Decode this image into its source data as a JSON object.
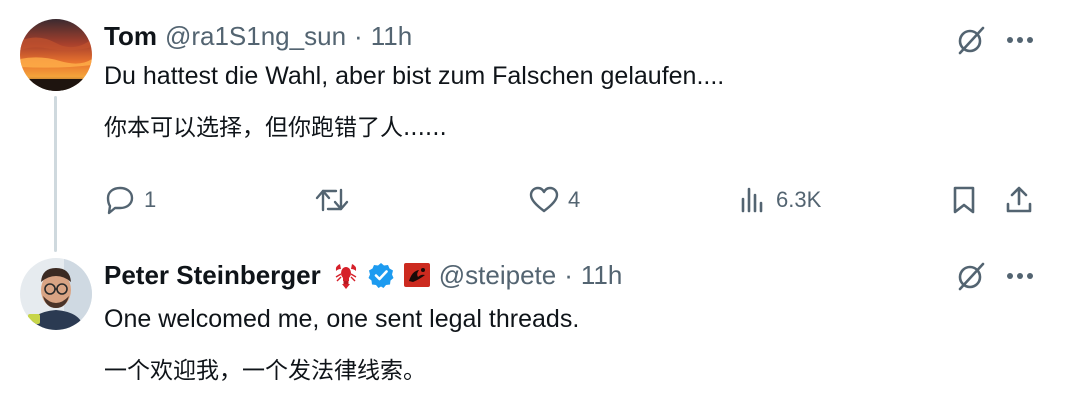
{
  "tweets": [
    {
      "name": "Tom",
      "handle": "@ra1S1ng_sun",
      "separator": "·",
      "time": "11h",
      "text_de": "Du hattest die Wahl, aber bist zum Falschen gelaufen....",
      "text_zh": "你本可以选择，但你跑错了人......",
      "actions": {
        "reply_count": "1",
        "like_count": "4",
        "views_count": "6.3K"
      }
    },
    {
      "name": "Peter Steinberger",
      "handle": "@steipete",
      "separator": "·",
      "time": "11h",
      "text_en": "One welcomed me, one sent legal threads.",
      "text_zh": "一个欢迎我，一个发法律线索。"
    }
  ],
  "colors": {
    "text": "#0f1419",
    "muted": "#536471",
    "verified_blue": "#1d9bf0",
    "thread_line": "#cfd9de",
    "lobster_red": "#d6202a"
  },
  "icons": [
    "grok-icon",
    "more-icon",
    "reply-icon",
    "retweet-icon",
    "like-icon",
    "views-icon",
    "bookmark-icon",
    "share-icon",
    "lobster-emoji",
    "verified-badge",
    "affiliate-badge"
  ]
}
